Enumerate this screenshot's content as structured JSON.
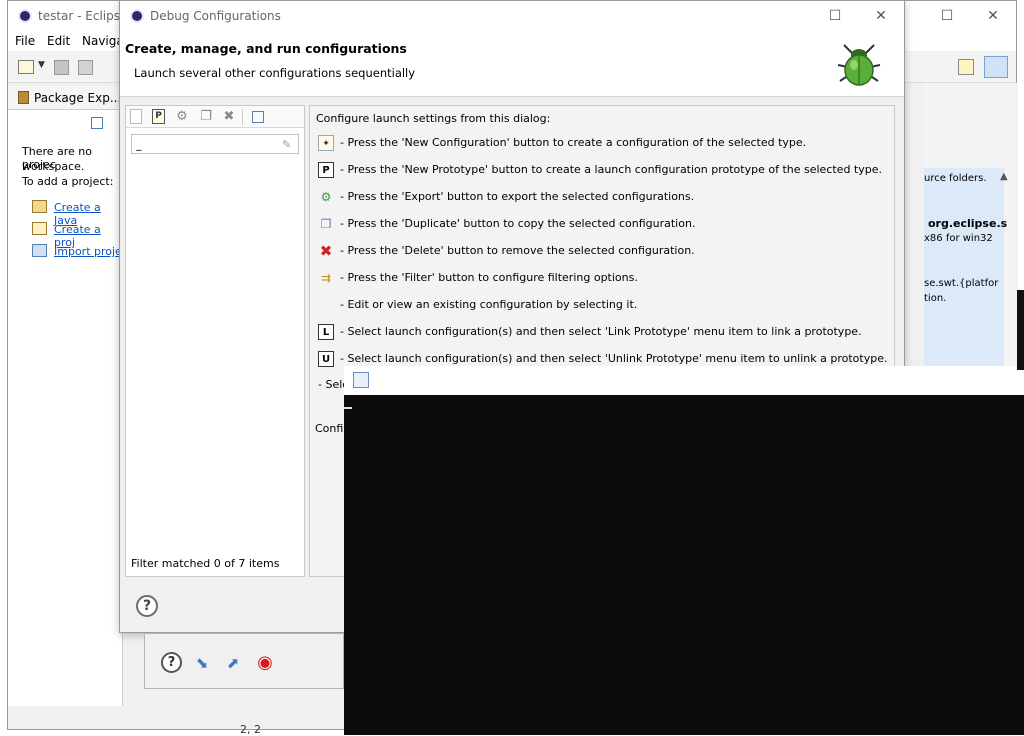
{
  "eclipse": {
    "title": "testar - Eclipse I",
    "menu": [
      "File",
      "Edit",
      "Navigati"
    ],
    "package_tab": "Package Exp...",
    "no_projects_line1": "There are no projec",
    "no_projects_line2": "workspace.",
    "add_project": "To add a project:",
    "links": [
      "Create a Java",
      "Create a proj",
      "Import proje"
    ],
    "right_texts": [
      "urce folders.",
      "org.eclipse.s",
      "x86 for win32",
      "se.swt.{platfor",
      "tion."
    ],
    "bottom_text": "2, 2"
  },
  "dialog": {
    "title": "Debug Configurations",
    "heading": "Create, manage, and run configurations",
    "subheading": "Launch several other configurations sequentially",
    "filter_value": "_",
    "filter_status": "Filter matched 0 of 7 items",
    "intro": "Configure launch settings from this dialog:",
    "hints": [
      {
        "icon": "new-config-icon",
        "text": "- Press the 'New Configuration' button to create a configuration of the selected type."
      },
      {
        "icon": "new-prototype-icon",
        "text": "- Press the 'New Prototype' button to create a launch configuration prototype of the selected type."
      },
      {
        "icon": "export-icon",
        "text": "- Press the 'Export' button to export the selected configurations."
      },
      {
        "icon": "duplicate-icon",
        "text": "- Press the 'Duplicate' button to copy the selected configuration."
      },
      {
        "icon": "delete-icon",
        "text": "- Press the 'Delete' button to remove the selected configuration."
      },
      {
        "icon": "filter-icon",
        "text": "- Press the 'Filter' button to configure filtering options."
      },
      {
        "icon": "",
        "text": "- Edit or view an existing configuration by selecting it."
      },
      {
        "icon": "link-prototype-icon",
        "text": "- Select launch configuration(s) and then select 'Link Prototype' menu item to link a prototype."
      },
      {
        "icon": "unlink-prototype-icon",
        "text": "- Select launch configuration(s) and then select 'Unlink Prototype' menu item to unlink a prototype."
      }
    ],
    "partial_line": "- Sele",
    "partial_config": "Confi"
  },
  "colors": {
    "console_bg": "#0c0c0c",
    "link": "#0b55c4",
    "delete_red": "#d62020"
  }
}
